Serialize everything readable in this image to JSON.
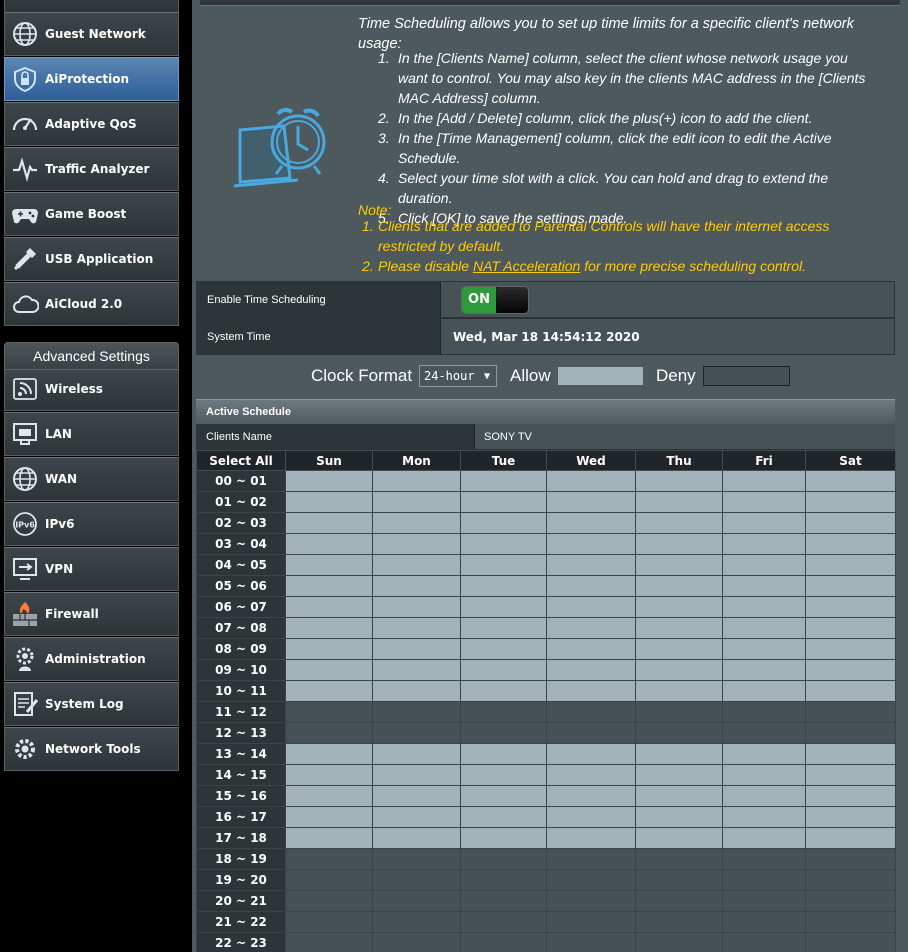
{
  "sidebar": {
    "top_items": [
      {
        "label": "Guest Network",
        "icon": "globe-icon"
      },
      {
        "label": "AiProtection",
        "icon": "shield-lock-icon",
        "active": true
      },
      {
        "label": "Adaptive QoS",
        "icon": "speedometer-icon"
      },
      {
        "label": "Traffic Analyzer",
        "icon": "pulse-icon"
      },
      {
        "label": "Game Boost",
        "icon": "gamepad-icon"
      },
      {
        "label": "USB Application",
        "icon": "usb-icon"
      },
      {
        "label": "AiCloud 2.0",
        "icon": "cloud-icon"
      }
    ],
    "advanced_header": "Advanced Settings",
    "advanced_items": [
      {
        "label": "Wireless",
        "icon": "wifi-icon"
      },
      {
        "label": "LAN",
        "icon": "lan-icon"
      },
      {
        "label": "WAN",
        "icon": "globe-icon"
      },
      {
        "label": "IPv6",
        "icon": "ipv6-icon"
      },
      {
        "label": "VPN",
        "icon": "vpn-icon"
      },
      {
        "label": "Firewall",
        "icon": "firewall-icon"
      },
      {
        "label": "Administration",
        "icon": "gear-user-icon"
      },
      {
        "label": "System Log",
        "icon": "log-icon"
      },
      {
        "label": "Network Tools",
        "icon": "tools-gear-icon"
      }
    ]
  },
  "intro": {
    "description": "Time Scheduling allows you to set up time limits for a specific client's network usage:",
    "steps": [
      "In the [Clients Name] column, select the client whose network usage you want to control. You may also key in the clients MAC address in the [Clients MAC Address] column.",
      "In the [Add / Delete] column, click the plus(+) icon to add the client.",
      "In the [Time Management] column, click the edit icon to edit the Active Schedule.",
      "Select your time slot with a click. You can hold and drag to extend the duration.",
      "Click [OK] to save the settings made."
    ],
    "note_title": "Note:",
    "note1": "Clients that are added to Parental Controls will have their internet access restricted by default.",
    "note2_prefix": "Please disable ",
    "note2_link": "NAT Acceleration",
    "note2_suffix": " for more precise scheduling control."
  },
  "settings": {
    "enable_label": "Enable Time Scheduling",
    "enable_state": "ON",
    "time_label": "System Time",
    "time_value": "Wed, Mar 18 14:54:12 2020"
  },
  "clock_format": {
    "label": "Clock Format",
    "selected": "24-hour",
    "allow_label": "Allow",
    "deny_label": "Deny",
    "allow_color": "#a2b3b9",
    "deny_color": "#475155"
  },
  "schedule": {
    "title": "Active Schedule",
    "clients_label": "Clients Name",
    "client_value": "SONY TV",
    "select_all": "Select All",
    "days": [
      "Sun",
      "Mon",
      "Tue",
      "Wed",
      "Thu",
      "Fri",
      "Sat"
    ],
    "hours": [
      "00 ~ 01",
      "01 ~ 02",
      "02 ~ 03",
      "03 ~ 04",
      "04 ~ 05",
      "05 ~ 06",
      "06 ~ 07",
      "07 ~ 08",
      "08 ~ 09",
      "09 ~ 10",
      "10 ~ 11",
      "11 ~ 12",
      "12 ~ 13",
      "13 ~ 14",
      "14 ~ 15",
      "15 ~ 16",
      "16 ~ 17",
      "17 ~ 18",
      "18 ~ 19",
      "19 ~ 20",
      "20 ~ 21",
      "21 ~ 22",
      "22 ~ 23"
    ],
    "allowed": [
      true,
      true,
      true,
      true,
      true,
      true,
      true,
      true,
      true,
      true,
      true,
      false,
      false,
      true,
      true,
      true,
      true,
      true,
      false,
      false,
      false,
      false,
      false
    ]
  }
}
